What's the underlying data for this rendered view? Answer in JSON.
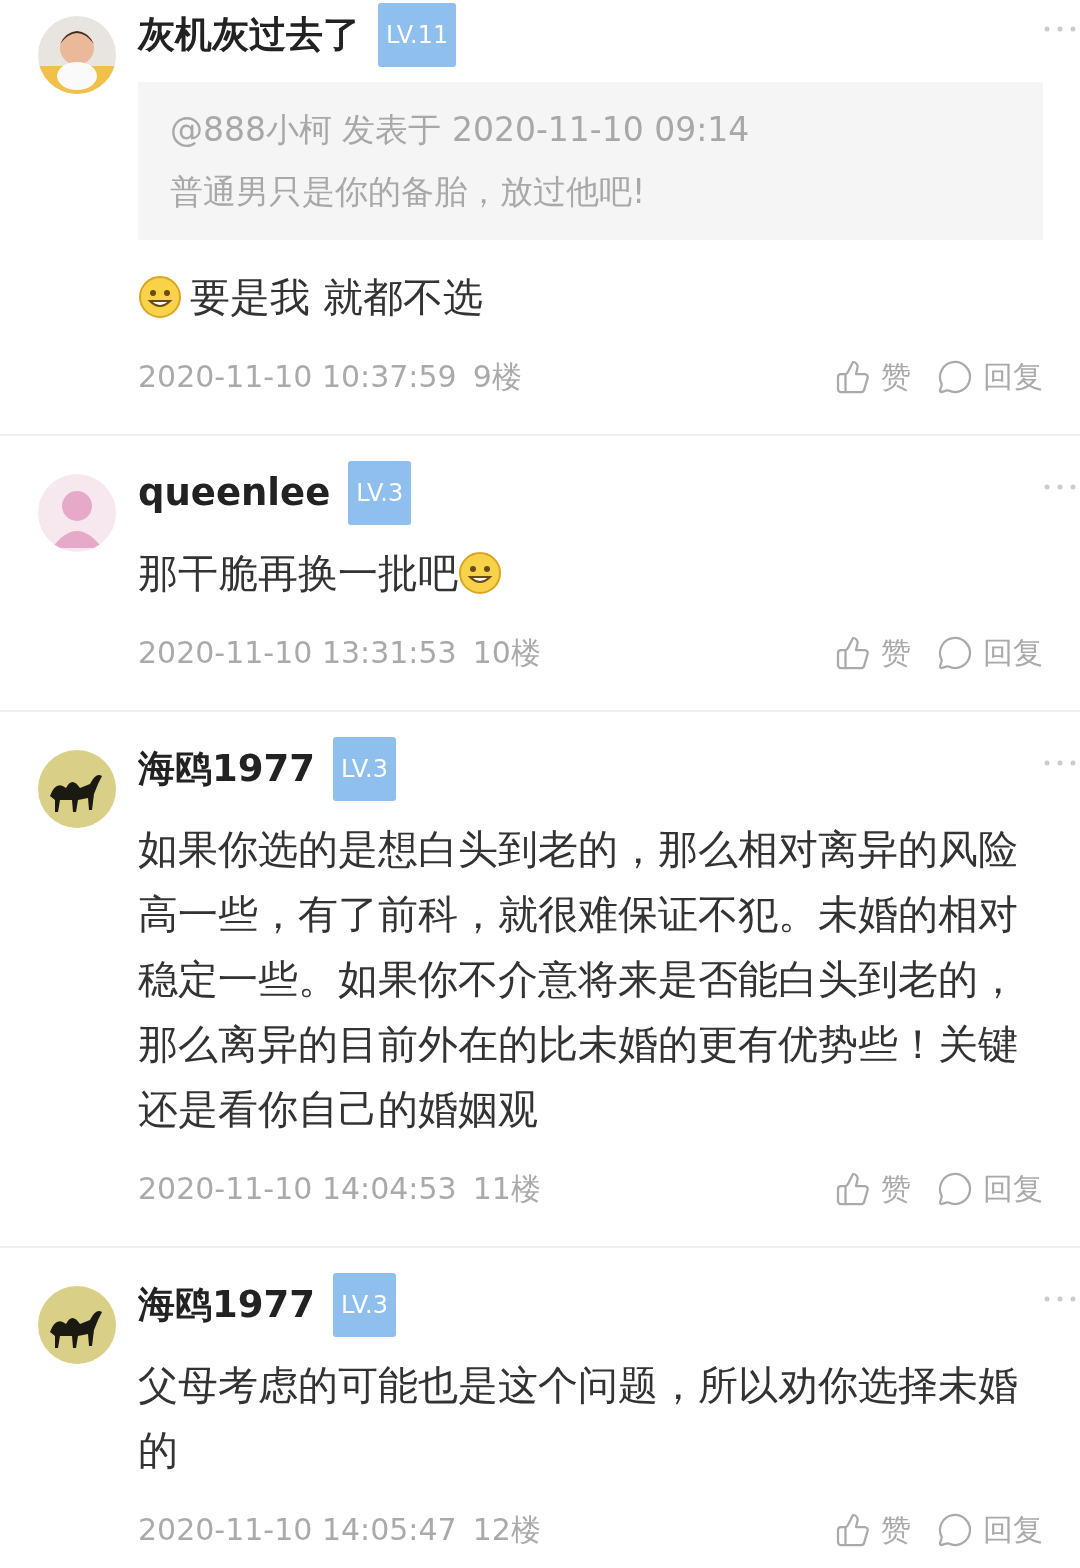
{
  "comments": [
    {
      "author": "灰机灰过去了",
      "level": "LV.11",
      "quote": {
        "header": "@888小柯 发表于 2020-11-10 09:14",
        "text": "普通男只是你的备胎，放过他吧!"
      },
      "body": [
        {
          "kind": "emoji"
        },
        {
          "kind": "text",
          "text": "要是我 就都不选"
        }
      ],
      "time": "2020-11-10 10:37:59",
      "floor": "9楼",
      "like": "赞",
      "reply": "回复"
    },
    {
      "author": "queenlee",
      "level": "LV.3",
      "avatar": {
        "kind": "silhouette"
      },
      "body": [
        {
          "kind": "text",
          "text": "那干脆再换一批吧"
        },
        {
          "kind": "emoji"
        }
      ],
      "time": "2020-11-10 13:31:53",
      "floor": "10楼",
      "like": "赞",
      "reply": "回复"
    },
    {
      "author": "海鸥1977",
      "level": "LV.3",
      "avatar": {
        "kind": "camel"
      },
      "body": [
        {
          "kind": "text",
          "text": "如果你选的是想白头到老的，那么相对离异的风险高一些，有了前科，就很难保证不犯。未婚的相对稳定一些。如果你不介意将来是否能白头到老的，那么离异的目前外在的比未婚的更有优势些！关键还是看你自己的婚姻观"
        }
      ],
      "time": "2020-11-10 14:04:53",
      "floor": "11楼",
      "like": "赞",
      "reply": "回复"
    },
    {
      "author": "海鸥1977",
      "level": "LV.3",
      "avatar": {
        "kind": "camel"
      },
      "body": [
        {
          "kind": "text",
          "text": "父母考虑的可能也是这个问题，所以劝你选择未婚的"
        }
      ],
      "time": "2020-11-10 14:05:47",
      "floor": "12楼",
      "like": "赞",
      "reply": "回复"
    }
  ]
}
